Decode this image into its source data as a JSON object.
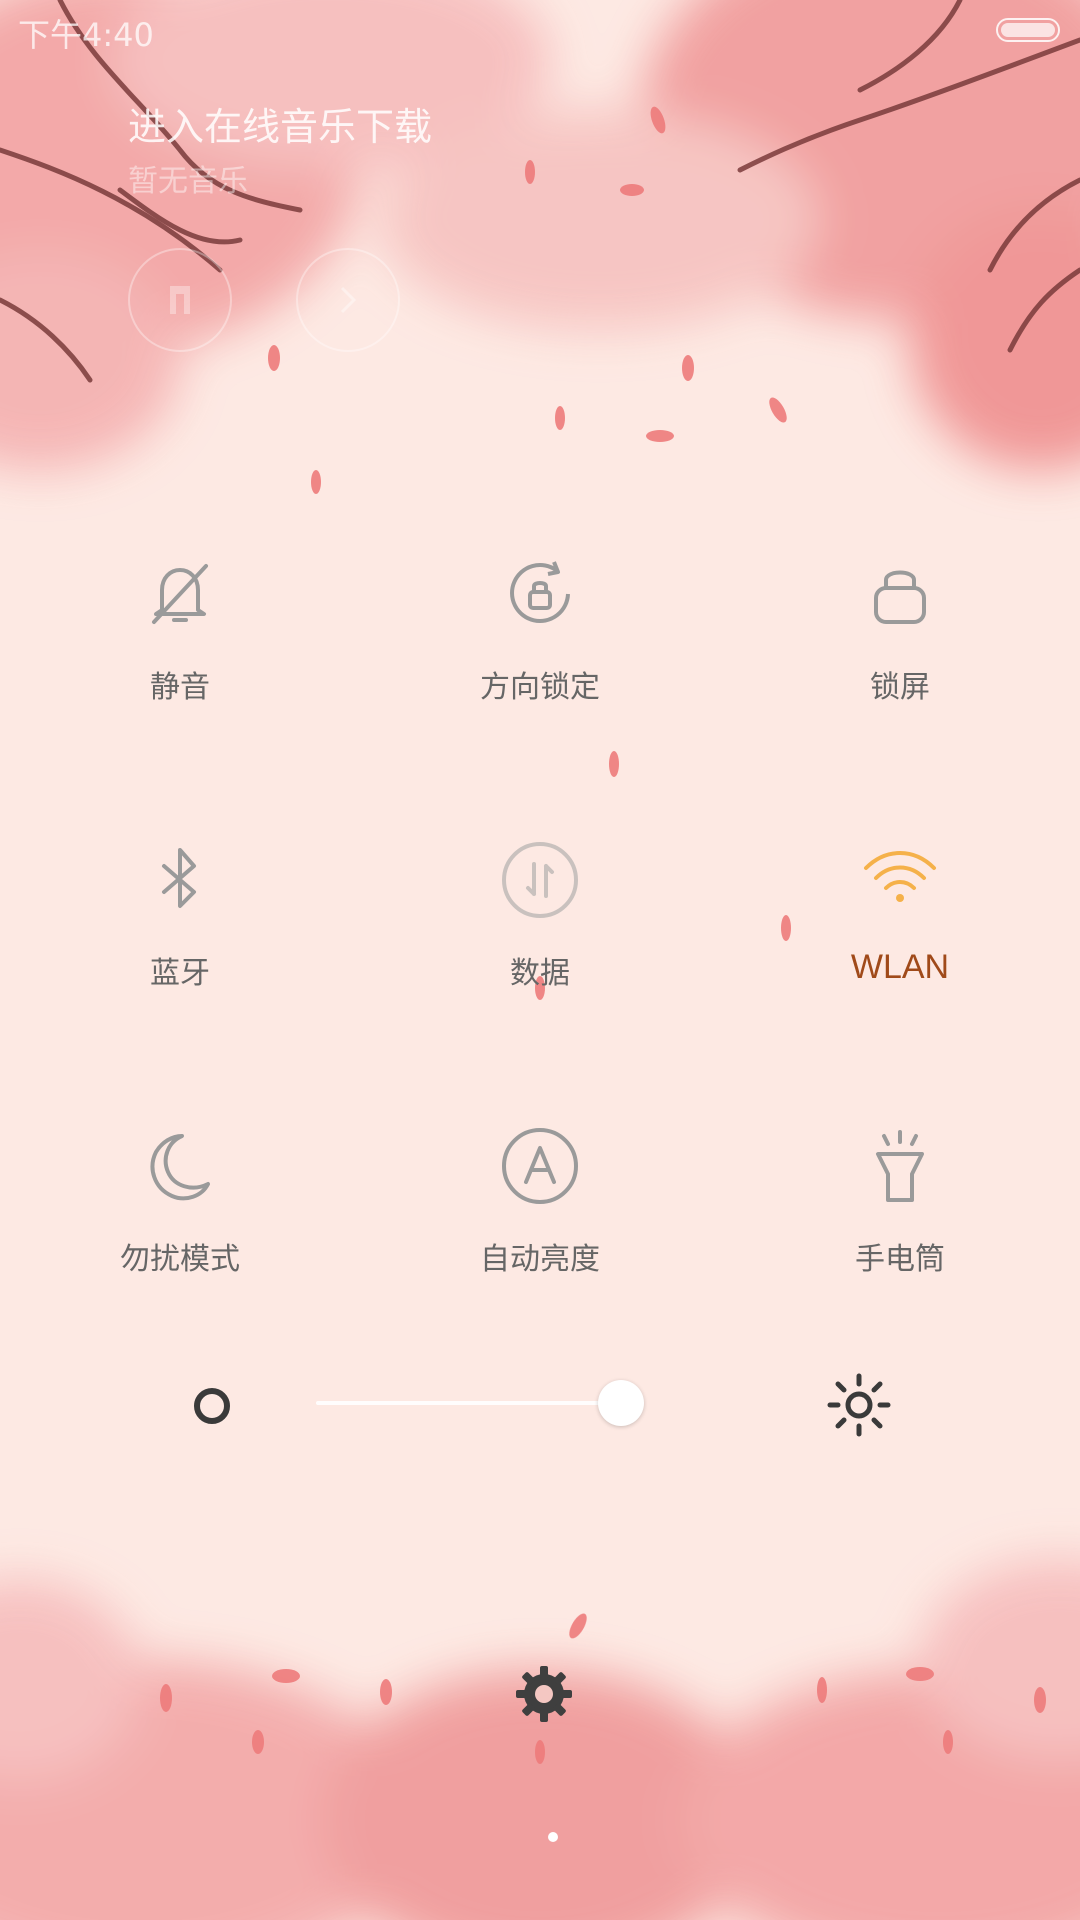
{
  "status_bar": {
    "time": "下午4:40"
  },
  "music": {
    "title": "进入在线音乐下载",
    "subtitle": "暂无音乐"
  },
  "toggles": [
    {
      "label": "静音",
      "icon": "bell-off-icon",
      "active": false
    },
    {
      "label": "方向锁定",
      "icon": "rotation-lock-icon",
      "active": false
    },
    {
      "label": "锁屏",
      "icon": "lock-icon",
      "active": false
    },
    {
      "label": "蓝牙",
      "icon": "bluetooth-icon",
      "active": false
    },
    {
      "label": "数据",
      "icon": "mobile-data-icon",
      "active": false
    },
    {
      "label": "WLAN",
      "icon": "wifi-icon",
      "active": true
    },
    {
      "label": "勿扰模式",
      "icon": "moon-icon",
      "active": false
    },
    {
      "label": "自动亮度",
      "icon": "auto-brightness-icon",
      "active": false
    },
    {
      "label": "手电筒",
      "icon": "flashlight-icon",
      "active": false
    }
  ],
  "brightness": {
    "level": 0.8
  },
  "colors": {
    "active": "#f5b14a",
    "active_label": "#a04a1a",
    "inactive": "#9a9a9a"
  }
}
